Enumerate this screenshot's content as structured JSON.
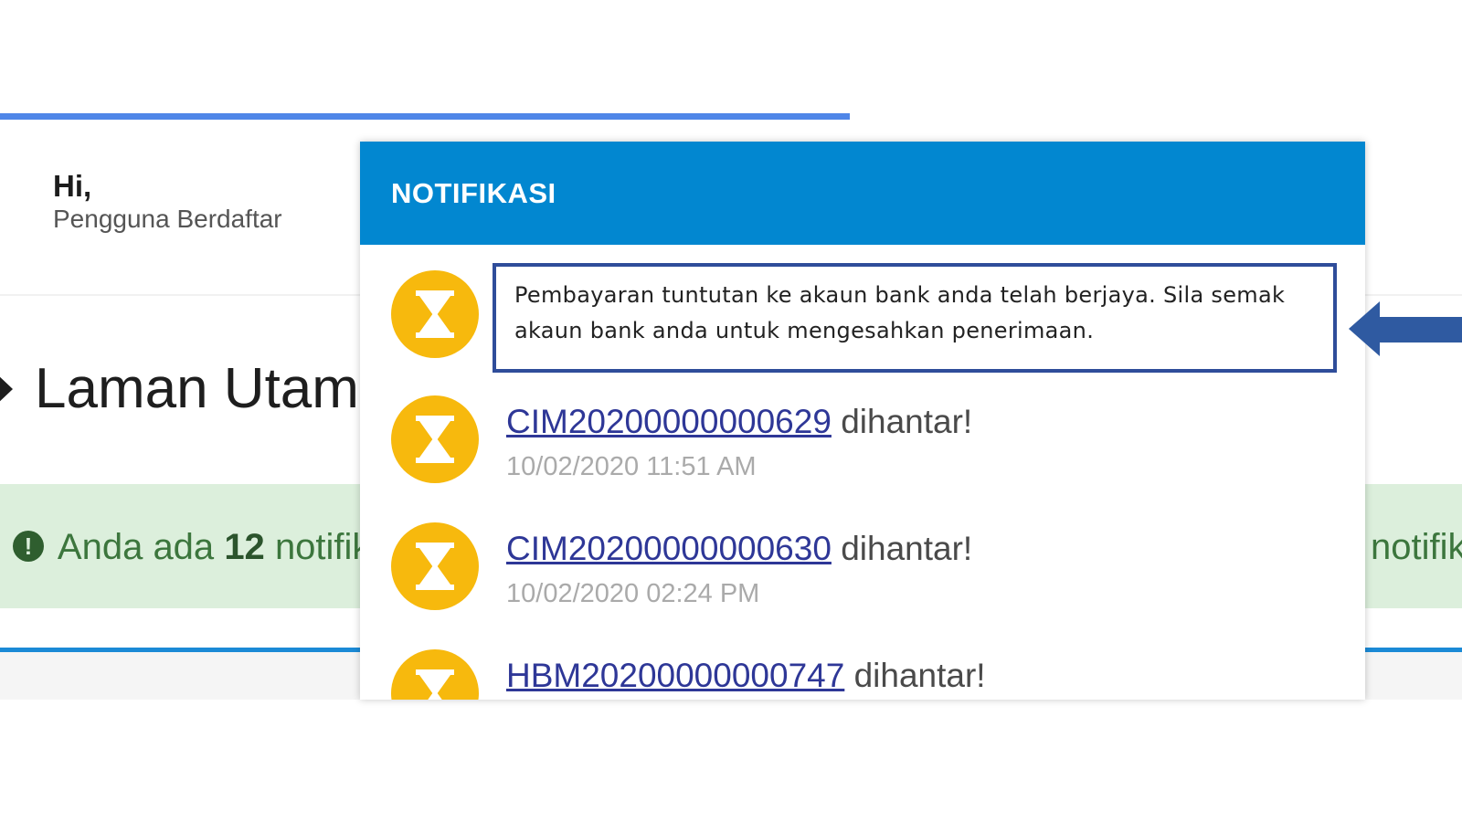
{
  "header": {
    "greeting": "Hi,",
    "user_label": "Pengguna Berdaftar"
  },
  "page": {
    "title": "Laman Utam"
  },
  "alert": {
    "prefix": "Anda ada",
    "count": "12",
    "suffix": "notifik",
    "right_fragment": "notifik"
  },
  "notifications": {
    "title": "NOTIFIKASI",
    "message": "Pembayaran tuntutan ke akaun bank anda telah berjaya. Sila semak akaun bank anda untuk mengesahkan penerimaan.",
    "items": [
      {
        "ref": "CIM20200000000629",
        "status": "dihantar!",
        "time": "10/02/2020 11:51 AM"
      },
      {
        "ref": "CIM20200000000630",
        "status": "dihantar!",
        "time": "10/02/2020 02:24 PM"
      },
      {
        "ref": "HBM20200000000747",
        "status": "dihantar!"
      }
    ]
  },
  "colors": {
    "header_blue": "#0287d0",
    "icon_yellow": "#f7b90d",
    "highlight_border": "#2f4d9a",
    "arrow": "#2f5aa1",
    "alert_bg": "#dcefdc"
  },
  "icons": {
    "notification_icon": "hourglass-icon",
    "alert_icon": "exclamation-circle-icon",
    "title_icon": "home-icon"
  }
}
